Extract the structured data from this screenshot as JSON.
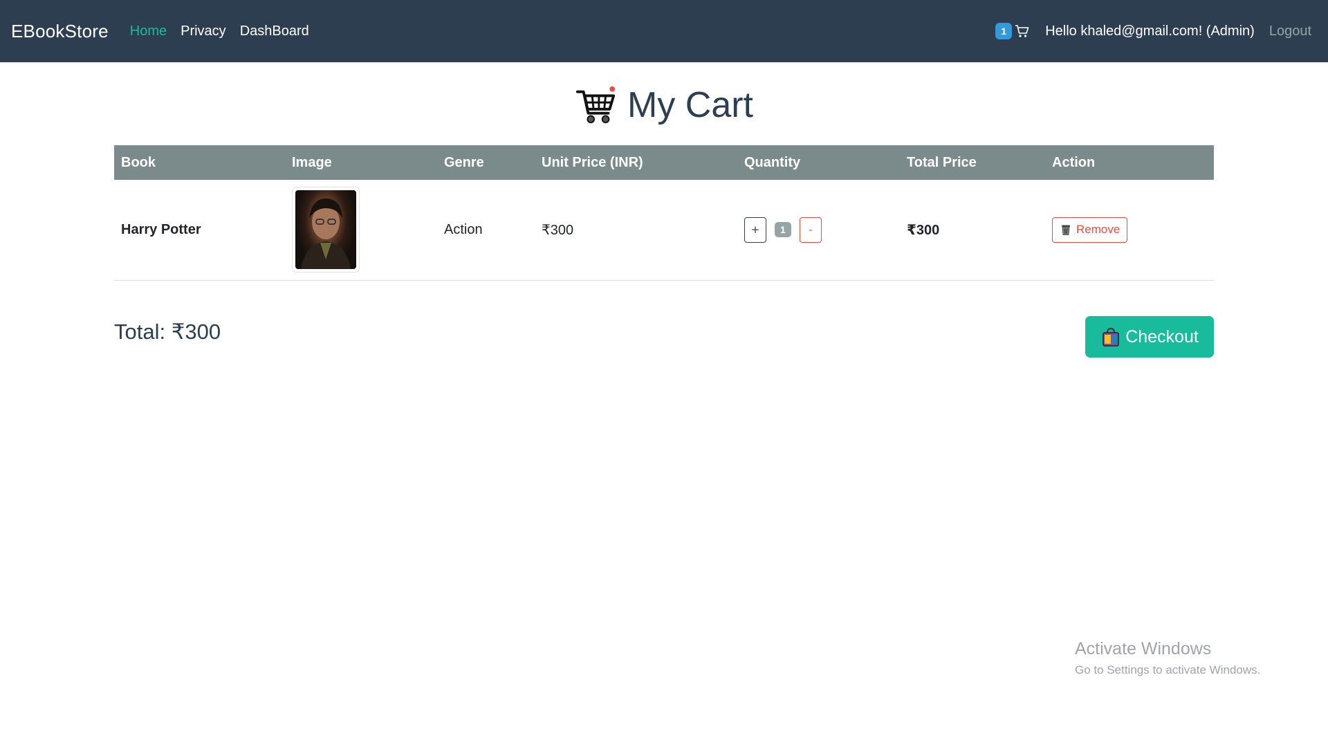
{
  "nav": {
    "brand": "EBookStore",
    "links": [
      {
        "label": "Home",
        "active": true
      },
      {
        "label": "Privacy",
        "active": false
      },
      {
        "label": "DashBoard",
        "active": false
      }
    ],
    "cart_count": "1",
    "greeting": "Hello khaled@gmail.com! (Admin)",
    "logout_label": "Logout"
  },
  "page": {
    "title": "My Cart",
    "title_icon": "shopping-cart-icon"
  },
  "table": {
    "headers": [
      "Book",
      "Image",
      "Genre",
      "Unit Price (INR)",
      "Quantity",
      "Total Price",
      "Action"
    ],
    "rows": [
      {
        "book": "Harry Potter",
        "image_icon": "book-cover-thumbnail",
        "genre": "Action",
        "unit_price": "₹300",
        "quantity": "1",
        "increment_label": "+",
        "decrement_label": "-",
        "total_price": "₹300",
        "remove_label": "Remove"
      }
    ]
  },
  "summary": {
    "total_label": "Total: ₹300",
    "checkout_label": "Checkout"
  },
  "watermark": {
    "title": "Activate Windows",
    "subtitle": "Go to Settings to activate Windows."
  },
  "colors": {
    "navbar": "#2c3e50",
    "accent": "#18bc9c",
    "danger": "#e74c3c",
    "table_header": "#7b8a8b",
    "badge": "#3498db"
  }
}
